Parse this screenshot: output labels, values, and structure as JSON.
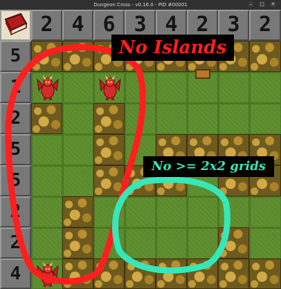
{
  "window": {
    "title": "Dungeon Cross - v0.16.0 - PID #00001",
    "controls": [
      "–",
      "□",
      "✕"
    ]
  },
  "game": {
    "book_icon": "red-book-icon",
    "column_clues": [
      "2",
      "4",
      "6",
      "3",
      "4",
      "2",
      "3",
      "2"
    ],
    "row_clues": [
      "5",
      "1",
      "2",
      "5",
      "5",
      "2",
      "2",
      "4"
    ],
    "tiles": [
      [
        "wall",
        "wall",
        "wall",
        "wall",
        "wall",
        "wall",
        "wall",
        "wall"
      ],
      [
        "monster",
        "grass",
        "monster",
        "grass",
        "grass",
        "grass",
        "grass",
        "grass"
      ],
      [
        "wall",
        "grass",
        "wall",
        "grass",
        "grass",
        "grass",
        "grass",
        "grass"
      ],
      [
        "grass",
        "grass",
        "wall",
        "grass",
        "wall",
        "wall",
        "wall",
        "wall"
      ],
      [
        "grass",
        "grass",
        "wall",
        "wall",
        "wall",
        "grass",
        "wall",
        "wall"
      ],
      [
        "grass",
        "wall",
        "grass",
        "grass",
        "grass",
        "grass",
        "grass",
        "grass"
      ],
      [
        "grass",
        "wall",
        "grass",
        "grass",
        "grass",
        "grass",
        "wall",
        "grass"
      ],
      [
        "monster",
        "wall",
        "wall",
        "wall",
        "wall",
        "wall",
        "wall",
        "wall"
      ]
    ],
    "treasure": "chest-icon"
  },
  "annotations": {
    "no_islands": "No Islands",
    "no_grids": "No >= 2x2 grids",
    "colors": {
      "red": "#ff1f1f",
      "teal": "#35e8b9"
    }
  }
}
